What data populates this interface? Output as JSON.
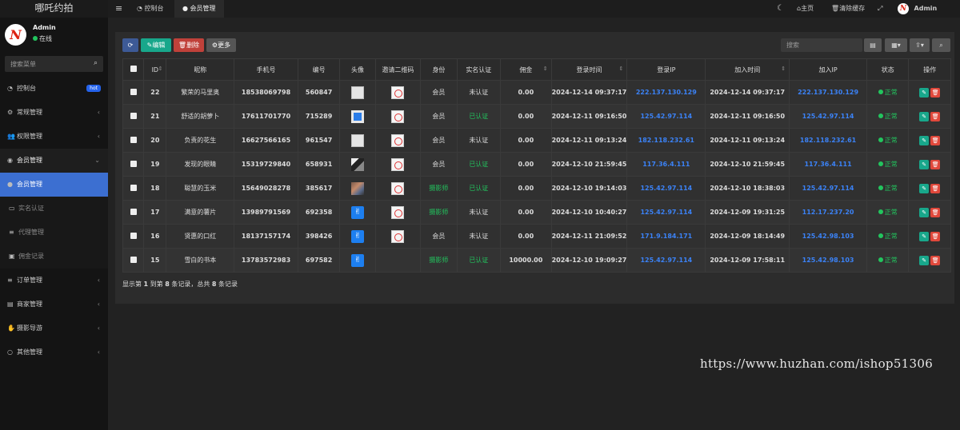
{
  "app": {
    "title": "哪吒约拍",
    "logo_letter": "N"
  },
  "user": {
    "name": "Admin",
    "status": "在线"
  },
  "sidebar": {
    "search_placeholder": "搜索菜单",
    "items": [
      {
        "label": "控制台",
        "icon": "dashboard-icon",
        "badge": "hot",
        "state": "normal"
      },
      {
        "label": "常规管理",
        "icon": "gears-icon",
        "arrow": "‹",
        "state": "normal"
      },
      {
        "label": "权限管理",
        "icon": "users-icon",
        "arrow": "‹",
        "state": "normal"
      },
      {
        "label": "会员管理",
        "icon": "user-circle-icon",
        "arrow": "⌄",
        "state": "open"
      },
      {
        "label": "会员管理",
        "icon": "user-icon",
        "state": "active"
      },
      {
        "label": "实名认证",
        "icon": "id-card-icon",
        "state": "sub"
      },
      {
        "label": "代理管理",
        "icon": "list-icon",
        "state": "sub"
      },
      {
        "label": "佣金记录",
        "icon": "money-icon",
        "state": "sub"
      },
      {
        "label": "订单管理",
        "icon": "list-icon",
        "arrow": "‹",
        "state": "normal"
      },
      {
        "label": "商家管理",
        "icon": "store-icon",
        "arrow": "‹",
        "state": "normal"
      },
      {
        "label": "摄影导游",
        "icon": "hand-icon",
        "arrow": "‹",
        "state": "normal"
      },
      {
        "label": "其他管理",
        "icon": "circle-icon",
        "arrow": "‹",
        "state": "normal"
      }
    ]
  },
  "topbar": {
    "tabs": [
      {
        "label": "控制台"
      },
      {
        "label": "会员管理"
      }
    ],
    "right": {
      "home": "主页",
      "clear_cache": "清除缓存",
      "admin": "Admin"
    }
  },
  "toolbar": {
    "edit": "编辑",
    "delete": "删除",
    "more": "更多",
    "search_placeholder": "搜索"
  },
  "table": {
    "columns": [
      "ID",
      "昵称",
      "手机号",
      "编号",
      "头像",
      "邀请二维码",
      "身份",
      "实名认证",
      "佣金",
      "登录时间",
      "登录IP",
      "加入时间",
      "加入IP",
      "状态",
      "操作"
    ],
    "rows": [
      {
        "id": "22",
        "nick": "繁荣的马里奥",
        "phone": "18538069798",
        "code": "560847",
        "avatar": "blank",
        "qr": true,
        "role": "会员",
        "verified": "未认证",
        "commission": "0.00",
        "login_time": "2024-12-14 09:37:17",
        "login_ip": "222.137.130.129",
        "join_time": "2024-12-14 09:37:17",
        "join_ip": "222.137.130.129",
        "status": "正常"
      },
      {
        "id": "21",
        "nick": "舒适的胡萝卜",
        "phone": "17611701770",
        "code": "715289",
        "avatar": "blue-frame",
        "qr": true,
        "role": "会员",
        "verified": "已认证",
        "commission": "0.00",
        "login_time": "2024-12-11 09:16:50",
        "login_ip": "125.42.97.114",
        "join_time": "2024-12-11 09:16:50",
        "join_ip": "125.42.97.114",
        "status": "正常"
      },
      {
        "id": "20",
        "nick": "负责的花生",
        "phone": "16627566165",
        "code": "961547",
        "avatar": "blank",
        "qr": true,
        "role": "会员",
        "verified": "未认证",
        "commission": "0.00",
        "login_time": "2024-12-11 09:13:24",
        "login_ip": "182.118.232.61",
        "join_time": "2024-12-11 09:13:24",
        "join_ip": "182.118.232.61",
        "status": "正常"
      },
      {
        "id": "19",
        "nick": "发现的眼睛",
        "phone": "15319729840",
        "code": "658931",
        "avatar": "photo-dark",
        "qr": true,
        "role": "会员",
        "verified": "已认证",
        "commission": "0.00",
        "login_time": "2024-12-10 21:59:45",
        "login_ip": "117.36.4.111",
        "join_time": "2024-12-10 21:59:45",
        "join_ip": "117.36.4.111",
        "status": "正常"
      },
      {
        "id": "18",
        "nick": "聪慧的玉米",
        "phone": "15649028278",
        "code": "385617",
        "avatar": "photo-color",
        "qr": true,
        "role": "摄影师",
        "verified": "已认证",
        "commission": "0.00",
        "login_time": "2024-12-10 19:14:03",
        "login_ip": "125.42.97.114",
        "join_time": "2024-12-10 18:38:03",
        "join_ip": "125.42.97.114",
        "status": "正常"
      },
      {
        "id": "17",
        "nick": "满意的薯片",
        "phone": "13989791569",
        "code": "692358",
        "avatar": "blue-hand",
        "qr": true,
        "role": "摄影师",
        "verified": "未认证",
        "commission": "0.00",
        "login_time": "2024-12-10 10:40:27",
        "login_ip": "125.42.97.114",
        "join_time": "2024-12-09 19:31:25",
        "join_ip": "112.17.237.20",
        "status": "正常"
      },
      {
        "id": "16",
        "nick": "贤惠的口红",
        "phone": "18137157174",
        "code": "398426",
        "avatar": "blue-hand",
        "qr": true,
        "role": "会员",
        "verified": "未认证",
        "commission": "0.00",
        "login_time": "2024-12-11 21:09:52",
        "login_ip": "171.9.184.171",
        "join_time": "2024-12-09 18:14:49",
        "join_ip": "125.42.98.103",
        "status": "正常"
      },
      {
        "id": "15",
        "nick": "雪白的书本",
        "phone": "13783572983",
        "code": "697582",
        "avatar": "blue-hand",
        "qr": false,
        "role": "摄影师",
        "verified": "已认证",
        "commission": "10000.00",
        "login_time": "2024-12-10 19:09:27",
        "login_ip": "125.42.97.114",
        "join_time": "2024-12-09 17:58:11",
        "join_ip": "125.42.98.103",
        "status": "正常"
      }
    ],
    "summary_parts": [
      "显示第 ",
      "1",
      " 到第 ",
      "8",
      " 条记录，总共 ",
      "8",
      " 条记录"
    ]
  },
  "watermark": "https://www.huzhan.com/ishop51306",
  "colors": {
    "accent": "#3c6fd1",
    "success": "#22c55e",
    "link": "#3b82f6",
    "danger": "#e0483b",
    "teal": "#18a78b"
  }
}
